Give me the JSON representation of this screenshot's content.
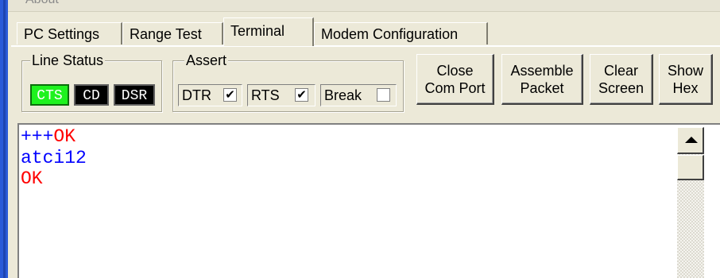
{
  "window": {
    "title_fragment": "About"
  },
  "tabs": [
    {
      "label": "PC Settings"
    },
    {
      "label": "Range Test"
    },
    {
      "label": "Terminal",
      "active": true
    },
    {
      "label": "Modem Configuration"
    }
  ],
  "line_status": {
    "label": "Line Status",
    "indicators": [
      {
        "label": "CTS",
        "state": "on",
        "color": "#1ef21e"
      },
      {
        "label": "CD",
        "state": "off",
        "color": "#000000"
      },
      {
        "label": "DSR",
        "state": "off",
        "color": "#000000"
      }
    ]
  },
  "assert": {
    "label": "Assert",
    "items": [
      {
        "label": "DTR",
        "checked": true,
        "mark": "✔"
      },
      {
        "label": "RTS",
        "checked": true,
        "mark": "✔"
      },
      {
        "label": "Break",
        "checked": false,
        "mark": ""
      }
    ]
  },
  "buttons": [
    {
      "label": "Close\nCom Port"
    },
    {
      "label": "Assemble\nPacket"
    },
    {
      "label": "Clear\nScreen"
    },
    {
      "label": "Show\nHex"
    }
  ],
  "terminal": {
    "lines": [
      {
        "text": "+++",
        "color": "#0000ff"
      },
      {
        "text": "OK",
        "color": "#ff0000"
      },
      {
        "text": "atci12",
        "color": "#0000ff"
      },
      {
        "text": "OK",
        "color": "#ff0000"
      }
    ]
  }
}
